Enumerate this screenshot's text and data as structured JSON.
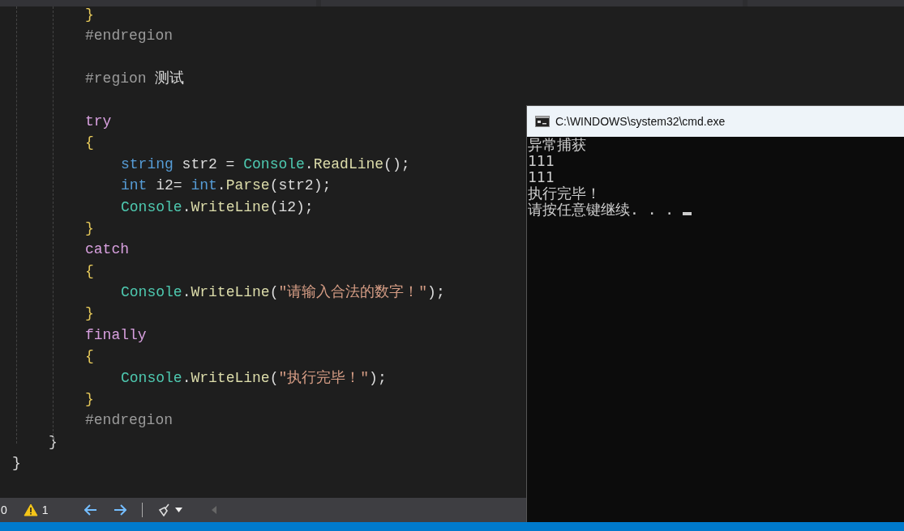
{
  "editor": {
    "lines": [
      {
        "kind": "block",
        "tokens": [
          {
            "kind": "brace",
            "text": "}"
          }
        ]
      },
      {
        "kind": "block",
        "tokens": [
          {
            "kind": "preproc",
            "text": "#endregion"
          }
        ]
      },
      {
        "kind": "blank"
      },
      {
        "kind": "block",
        "tokens": [
          {
            "kind": "preproc",
            "text": "#region "
          },
          {
            "kind": "plain",
            "text": "测试"
          }
        ]
      },
      {
        "kind": "blank"
      },
      {
        "kind": "block",
        "tokens": [
          {
            "kind": "control",
            "text": "try"
          }
        ]
      },
      {
        "kind": "block",
        "tokens": [
          {
            "kind": "brace",
            "text": "{"
          }
        ]
      },
      {
        "kind": "nested",
        "tokens": [
          {
            "kind": "keyword",
            "text": "string"
          },
          {
            "kind": "plain",
            "text": " str2 = "
          },
          {
            "kind": "type",
            "text": "Console"
          },
          {
            "kind": "plain",
            "text": "."
          },
          {
            "kind": "method",
            "text": "ReadLine"
          },
          {
            "kind": "plain",
            "text": "();"
          }
        ]
      },
      {
        "kind": "nested",
        "tokens": [
          {
            "kind": "keyword",
            "text": "int"
          },
          {
            "kind": "plain",
            "text": " i2= "
          },
          {
            "kind": "keyword",
            "text": "int"
          },
          {
            "kind": "plain",
            "text": "."
          },
          {
            "kind": "method",
            "text": "Parse"
          },
          {
            "kind": "plain",
            "text": "(str2);"
          }
        ]
      },
      {
        "kind": "nested",
        "tokens": [
          {
            "kind": "type",
            "text": "Console"
          },
          {
            "kind": "plain",
            "text": "."
          },
          {
            "kind": "method",
            "text": "WriteLine"
          },
          {
            "kind": "plain",
            "text": "(i2);"
          }
        ]
      },
      {
        "kind": "block",
        "tokens": [
          {
            "kind": "brace",
            "text": "}"
          }
        ]
      },
      {
        "kind": "block",
        "tokens": [
          {
            "kind": "control",
            "text": "catch"
          }
        ]
      },
      {
        "kind": "block",
        "tokens": [
          {
            "kind": "brace",
            "text": "{"
          }
        ]
      },
      {
        "kind": "nested",
        "tokens": [
          {
            "kind": "type",
            "text": "Console"
          },
          {
            "kind": "plain",
            "text": "."
          },
          {
            "kind": "method",
            "text": "WriteLine"
          },
          {
            "kind": "plain",
            "text": "("
          },
          {
            "kind": "string",
            "text": "\"请输入合法的数字！\""
          },
          {
            "kind": "plain",
            "text": ");"
          }
        ]
      },
      {
        "kind": "block",
        "tokens": [
          {
            "kind": "brace",
            "text": "}"
          }
        ]
      },
      {
        "kind": "block",
        "tokens": [
          {
            "kind": "control",
            "text": "finally"
          }
        ]
      },
      {
        "kind": "block",
        "tokens": [
          {
            "kind": "brace",
            "text": "{"
          }
        ]
      },
      {
        "kind": "nested",
        "tokens": [
          {
            "kind": "type",
            "text": "Console"
          },
          {
            "kind": "plain",
            "text": "."
          },
          {
            "kind": "method",
            "text": "WriteLine"
          },
          {
            "kind": "plain",
            "text": "("
          },
          {
            "kind": "string",
            "text": "\"执行完毕！\""
          },
          {
            "kind": "plain",
            "text": ");"
          }
        ]
      },
      {
        "kind": "block",
        "tokens": [
          {
            "kind": "brace",
            "text": "}"
          }
        ]
      },
      {
        "kind": "block",
        "tokens": [
          {
            "kind": "preproc",
            "text": "#endregion"
          }
        ]
      },
      {
        "kind": "outer",
        "tokens": [
          {
            "kind": "plain",
            "text": "}"
          }
        ]
      },
      {
        "kind": "outermost",
        "tokens": [
          {
            "kind": "plain",
            "text": "}"
          }
        ]
      }
    ]
  },
  "status_bar": {
    "errors": "0",
    "warnings": "1"
  },
  "console": {
    "title": "C:\\WINDOWS\\system32\\cmd.exe",
    "output": [
      "异常捕获",
      "111",
      "111",
      "执行完毕！",
      "请按任意键继续. . . "
    ]
  }
}
